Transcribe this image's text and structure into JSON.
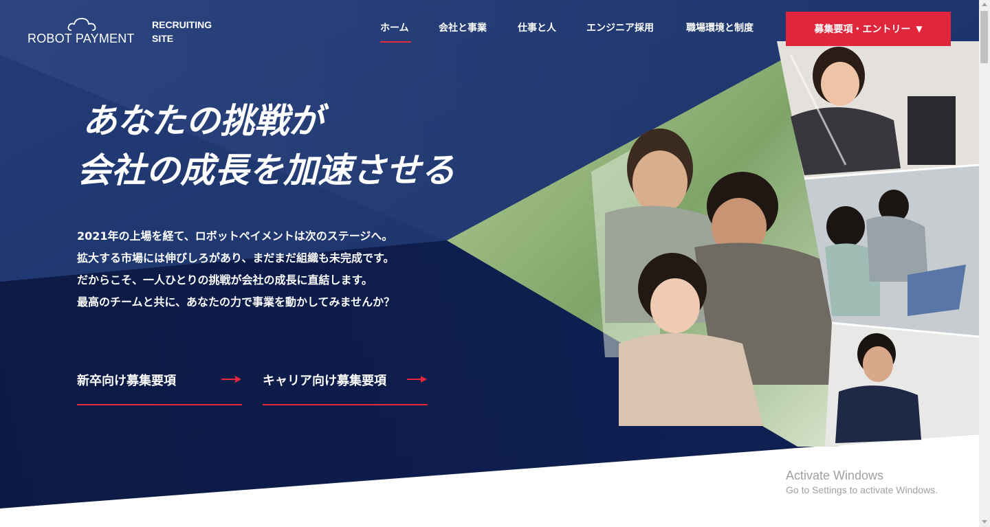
{
  "header": {
    "logo_text": "ROBOT PAYMENT",
    "site_label_line1": "RECRUITING",
    "site_label_line2": "SITE",
    "nav": [
      {
        "label": "ホーム",
        "active": true
      },
      {
        "label": "会社と事業",
        "active": false
      },
      {
        "label": "仕事と人",
        "active": false
      },
      {
        "label": "エンジニア採用",
        "active": false
      },
      {
        "label": "職場環境と制度",
        "active": false
      }
    ],
    "entry_button": {
      "label": "募集要項・エントリー",
      "caret": "▼"
    }
  },
  "hero": {
    "headline_line1": "あなたの挑戦が",
    "headline_line2": "会社の成長を加速させる",
    "body_lines": [
      "2021年の上場を経て、ロボットペイメントは次のステージへ。",
      "拡大する市場には伸びしろがあり、まだまだ組織も未完成です。",
      "だからこそ、一人ひとりの挑戦が会社の成長に直結します。",
      "最高のチームと共に、あなたの力で事業を動かしてみませんか？"
    ],
    "links": [
      {
        "label": "新卒向け募集要項"
      },
      {
        "label": "キャリア向け募集要項"
      }
    ]
  },
  "os_overlay": {
    "activate_title": "Activate Windows",
    "activate_subtitle": "Go to Settings to activate Windows."
  },
  "colors": {
    "navy_dark": "#0b1a45",
    "navy_mid": "#1f3770",
    "accent_red": "#e0263a",
    "white": "#ffffff"
  },
  "icons": [
    "cloud-icon",
    "arrow-right-icon",
    "caret-down-icon"
  ]
}
